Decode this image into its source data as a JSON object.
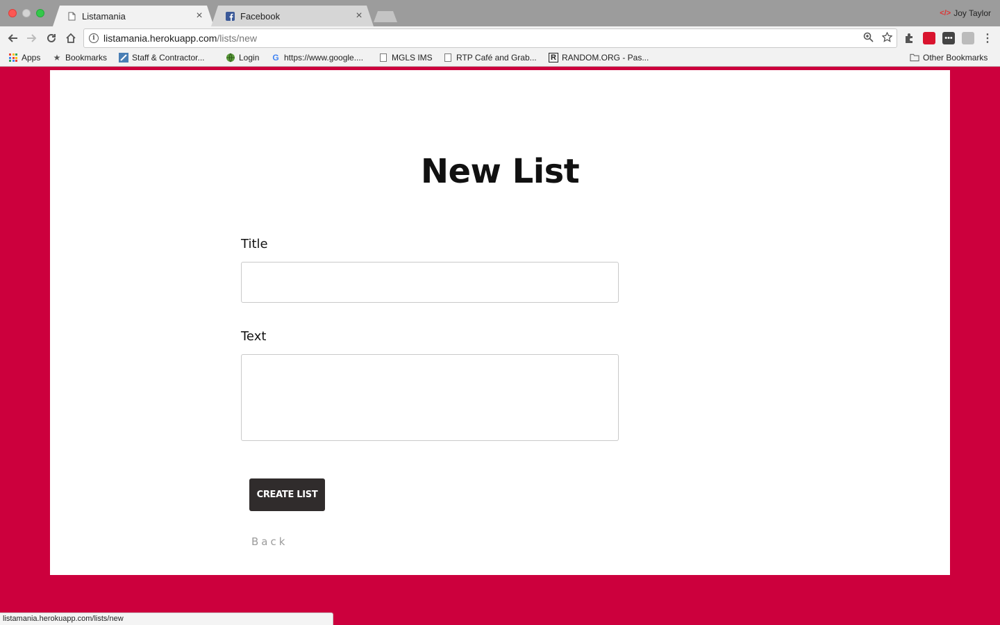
{
  "browser": {
    "tabs": [
      {
        "title": "Listamania",
        "icon": "document-icon",
        "active": true
      },
      {
        "title": "Facebook",
        "icon": "facebook-icon",
        "active": false
      }
    ],
    "profile_name": "Joy Taylor",
    "url_host": "listamania.herokuapp.com",
    "url_path": "/lists/new",
    "bookmarks": [
      {
        "label": "Apps",
        "icon": "apps-grid-icon"
      },
      {
        "label": "Bookmarks",
        "icon": "star-icon"
      },
      {
        "label": "Staff & Contractor...",
        "icon": "staff-portal-icon"
      },
      {
        "label": "Login",
        "icon": "globe-icon"
      },
      {
        "label": "https://www.google....",
        "icon": "google-icon"
      },
      {
        "label": "MGLS IMS",
        "icon": "document-icon"
      },
      {
        "label": "RTP Café and Grab...",
        "icon": "document-icon"
      },
      {
        "label": "RANDOM.ORG - Pas...",
        "icon": "random-org-icon"
      }
    ],
    "other_bookmarks": "Other Bookmarks",
    "status_url": "listamania.herokuapp.com/lists/new"
  },
  "page": {
    "title": "New List",
    "title_label": "Title",
    "title_value": "",
    "text_label": "Text",
    "text_value": "",
    "submit_label": "CREATE LIST",
    "back_label": "Back"
  },
  "colors": {
    "page_background": "#cc003d",
    "card_background": "#ffffff",
    "button_background": "#302c2c",
    "back_link": "#9b9b9b"
  }
}
